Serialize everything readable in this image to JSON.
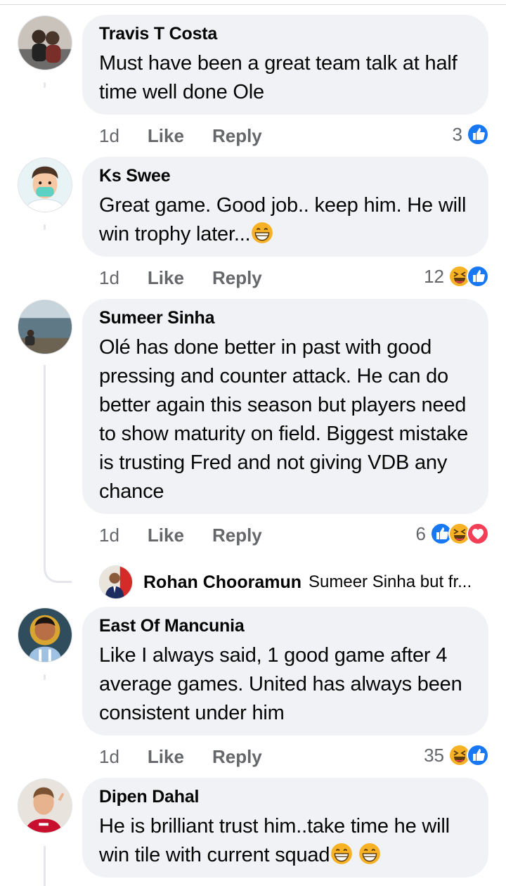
{
  "comments": [
    {
      "author": "Travis T Costa",
      "text": "Must have been a great team talk at half time well done Ole",
      "time": "1d",
      "like": "Like",
      "reply": "Reply",
      "reaction_count": "3",
      "reactions": [
        "like-icon"
      ]
    },
    {
      "author": "Ks Swee",
      "text": "Great game. Good job..  keep him. He will win trophy later...",
      "time": "1d",
      "like": "Like",
      "reply": "Reply",
      "reaction_count": "12",
      "reactions": [
        "haha-icon",
        "like-icon"
      ]
    },
    {
      "author": "Sumeer Sinha",
      "text": "Olé has done better in past with good pressing and counter attack. He can do better again this season but players need to show maturity on field. Biggest mistake is trusting Fred and not giving VDB any chance",
      "time": "1d",
      "like": "Like",
      "reply": "Reply",
      "reaction_count": "6",
      "reactions": [
        "like-icon",
        "haha-icon",
        "love-icon"
      ],
      "reply_preview": {
        "author": "Rohan Chooramun",
        "text": "Sumeer Sinha but fr..."
      }
    },
    {
      "author": "East Of Mancunia",
      "text": "Like I always said, 1 good game after 4 average games. United has always been consistent under him",
      "time": "1d",
      "like": "Like",
      "reply": "Reply",
      "reaction_count": "35",
      "reactions": [
        "haha-icon",
        "like-icon"
      ]
    },
    {
      "author": "Dipen Dahal",
      "text": "He is brilliant trust him..take time he will win tile with current squad"
    }
  ],
  "colors": {
    "like_blue": "#1877f2",
    "haha_yellow": "#f7b125",
    "love_red": "#f33e58",
    "bubble_bg": "#f0f2f5",
    "meta_gray": "#65676b"
  }
}
